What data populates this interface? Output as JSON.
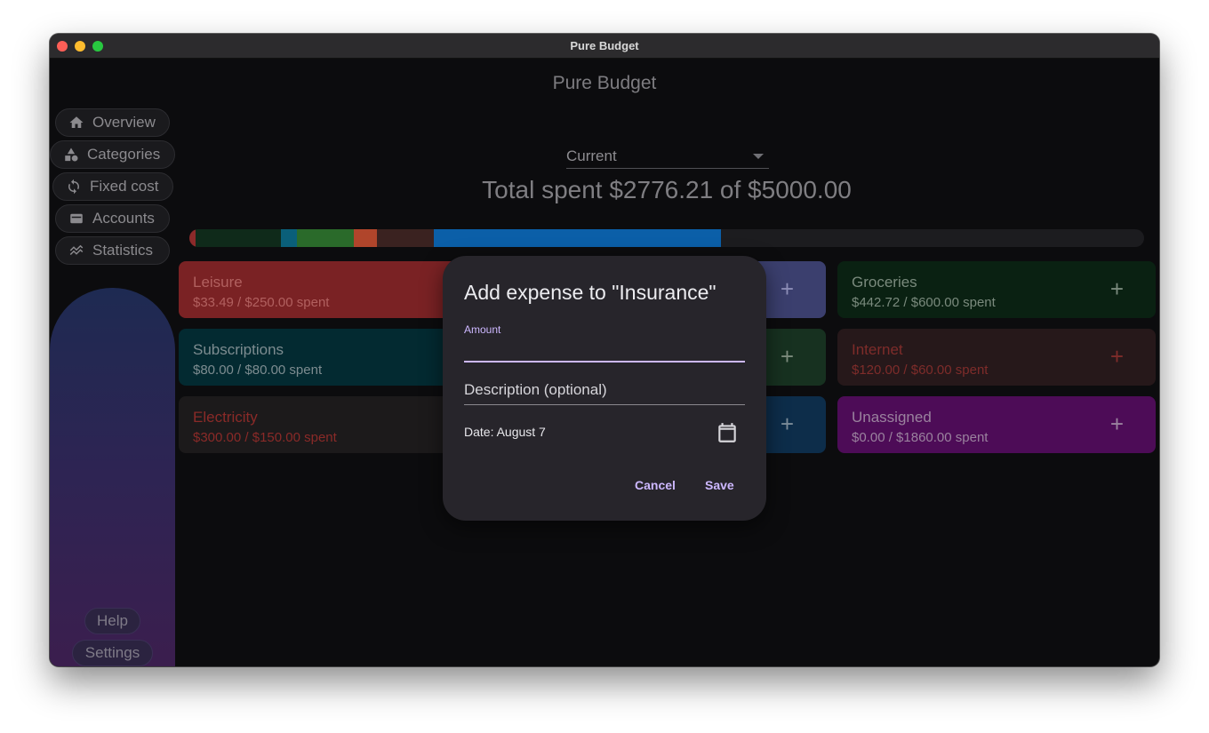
{
  "window": {
    "title": "Pure Budget"
  },
  "app": {
    "title": "Pure Budget"
  },
  "sidebar": {
    "items": [
      {
        "label": "Overview",
        "icon": "home-icon"
      },
      {
        "label": "Categories",
        "icon": "shapes-icon"
      },
      {
        "label": "Fixed cost",
        "icon": "sync-icon"
      },
      {
        "label": "Accounts",
        "icon": "wallet-icon"
      },
      {
        "label": "Statistics",
        "icon": "stats-icon"
      }
    ],
    "help_label": "Help",
    "settings_label": "Settings"
  },
  "period": {
    "selected": "Current"
  },
  "summary": {
    "total_text": "Total spent $2776.21 of $5000.00"
  },
  "progress": {
    "spent": 2776.21,
    "budget": 5000.0,
    "colors": [
      "#8c2a2a",
      "#0f2a1a",
      "#0a5f79",
      "#2a6a2a",
      "#b0452b",
      "#3a2220",
      "#0b5fa8"
    ]
  },
  "categories": [
    {
      "name": "Leisure",
      "sub": "$33.49 / $250.00 spent",
      "color": "#7a2224"
    },
    {
      "name": "Subscriptions",
      "sub": "$80.00 / $80.00 spent",
      "color": "#032a31"
    },
    {
      "name": "Electricity",
      "sub": "$300.00 / $150.00 spent",
      "color": "#1c1a1b"
    },
    {
      "name": "Groceries",
      "sub": "$442.72 / $600.00 spent",
      "color": "#0a2112"
    },
    {
      "name": "Internet",
      "sub": "$120.00 / $60.00 spent",
      "color": "#26181a"
    },
    {
      "name": "Unassigned",
      "sub": "$0.00 / $1860.00 spent",
      "color": "#4d0c57"
    }
  ],
  "dialog": {
    "title": "Add expense to \"Insurance\"",
    "amount_label": "Amount",
    "amount_value": "",
    "description_placeholder": "Description (optional)",
    "date_text": "Date: August 7",
    "cancel_label": "Cancel",
    "save_label": "Save"
  },
  "colors": {
    "accent": "#cdb8ff",
    "overspent": "#c0392b"
  }
}
